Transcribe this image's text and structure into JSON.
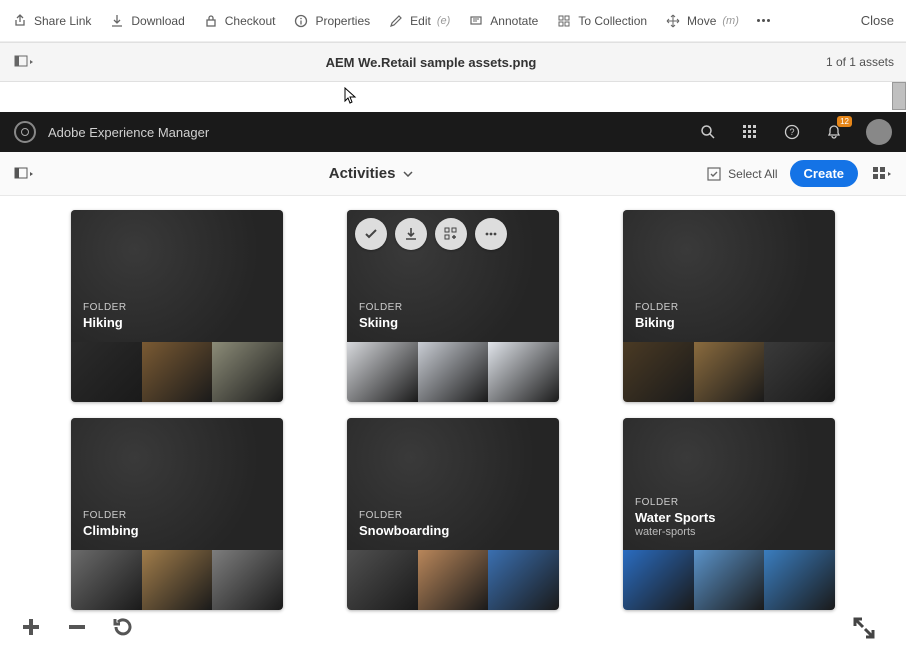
{
  "toolbar": {
    "share": "Share Link",
    "download": "Download",
    "checkout": "Checkout",
    "properties": "Properties",
    "edit": "Edit",
    "edit_shortcut": "(e)",
    "annotate": "Annotate",
    "to_collection": "To Collection",
    "move": "Move",
    "move_shortcut": "(m)",
    "close": "Close"
  },
  "titlebar": {
    "title": "AEM We.Retail sample assets.png",
    "counter": "1 of 1 assets"
  },
  "aem_header": {
    "product": "Adobe Experience Manager",
    "badge": "12"
  },
  "activities": {
    "breadcrumb": "Activities",
    "select_all": "Select All",
    "create": "Create"
  },
  "folder_label": "FOLDER",
  "cards": [
    {
      "title": "Hiking",
      "subtitle": "",
      "thumbs": [
        "#2b2b2b",
        "#7a5a33",
        "#8c8c78"
      ],
      "hovered": false
    },
    {
      "title": "Skiing",
      "subtitle": "",
      "thumbs": [
        "#d6d8dc",
        "#c9cdd4",
        "#e0e4ea"
      ],
      "hovered": true
    },
    {
      "title": "Biking",
      "subtitle": "",
      "thumbs": [
        "#4a3a24",
        "#8a6b3e",
        "#3a3a3a"
      ],
      "hovered": false
    },
    {
      "title": "Climbing",
      "subtitle": "",
      "thumbs": [
        "#6b6b6b",
        "#a07c4a",
        "#7d7d7d"
      ],
      "hovered": false
    },
    {
      "title": "Snowboarding",
      "subtitle": "",
      "thumbs": [
        "#505050",
        "#b8865a",
        "#3a6fb0"
      ],
      "hovered": false
    },
    {
      "title": "Water Sports",
      "subtitle": "water-sports",
      "thumbs": [
        "#2a6cc0",
        "#5a92c8",
        "#3a7dbf"
      ],
      "hovered": false
    }
  ],
  "colors": {
    "primary": "#1473e6",
    "badge": "#e68619"
  }
}
